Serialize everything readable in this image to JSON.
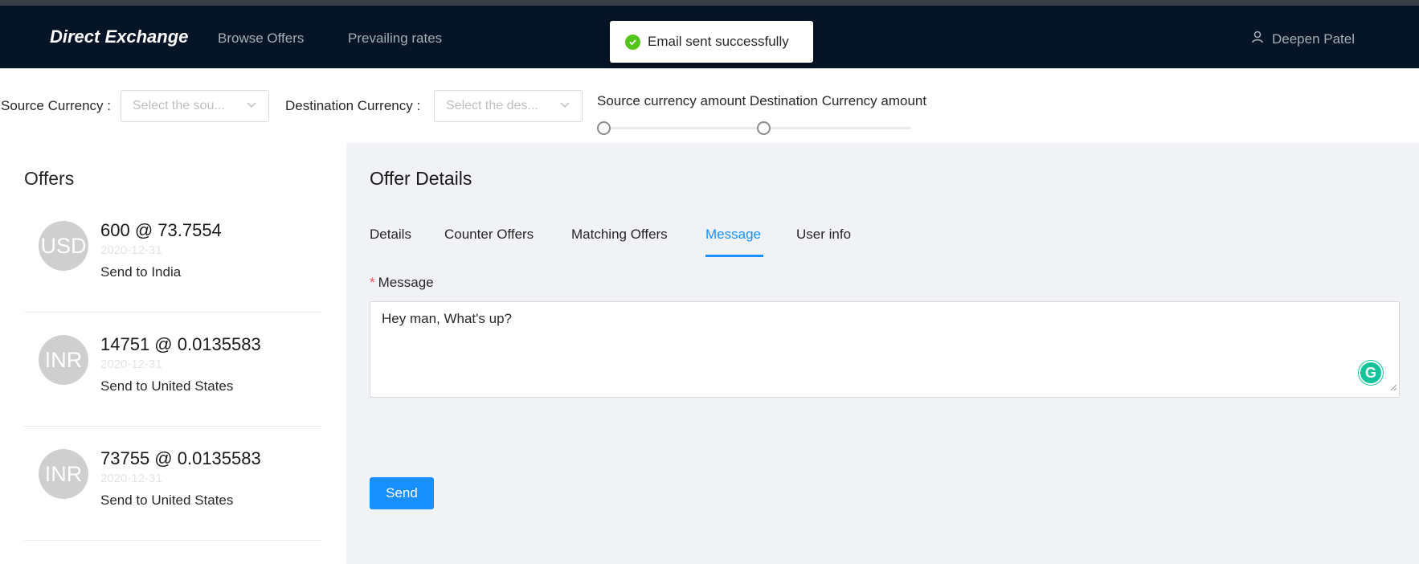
{
  "nav": {
    "brand": "Direct Exchange",
    "links": [
      "Browse Offers",
      "Prevailing rates"
    ],
    "user": "Deepen Patel"
  },
  "toast": {
    "text": "Email sent successfully"
  },
  "filters": {
    "source_label": "Source Currency",
    "source_placeholder": "Select the sou...",
    "dest_label": "Destination Currency",
    "dest_placeholder": "Select the des...",
    "slider_labels": "Source currency amount Destination Currency amount"
  },
  "offers": {
    "title": "Offers",
    "items": [
      {
        "currency": "USD",
        "title": "600 @ 73.7554",
        "date": "2020-12-31",
        "desc": "Send to India"
      },
      {
        "currency": "INR",
        "title": "14751 @ 0.0135583",
        "date": "2020-12-31",
        "desc": "Send to United States"
      },
      {
        "currency": "INR",
        "title": "73755 @ 0.0135583",
        "date": "2020-12-31",
        "desc": "Send to United States"
      }
    ]
  },
  "details": {
    "title": "Offer Details",
    "tabs": [
      "Details",
      "Counter Offers",
      "Matching Offers",
      "Message",
      "User info"
    ],
    "active_tab": "Message",
    "message_label": "Message",
    "message_value": "Hey man, What's up?",
    "send_label": "Send"
  },
  "colors": {
    "navbar": "#061427",
    "accent": "#1890ff",
    "success": "#52c41a",
    "panel": "#f0f2f5"
  }
}
